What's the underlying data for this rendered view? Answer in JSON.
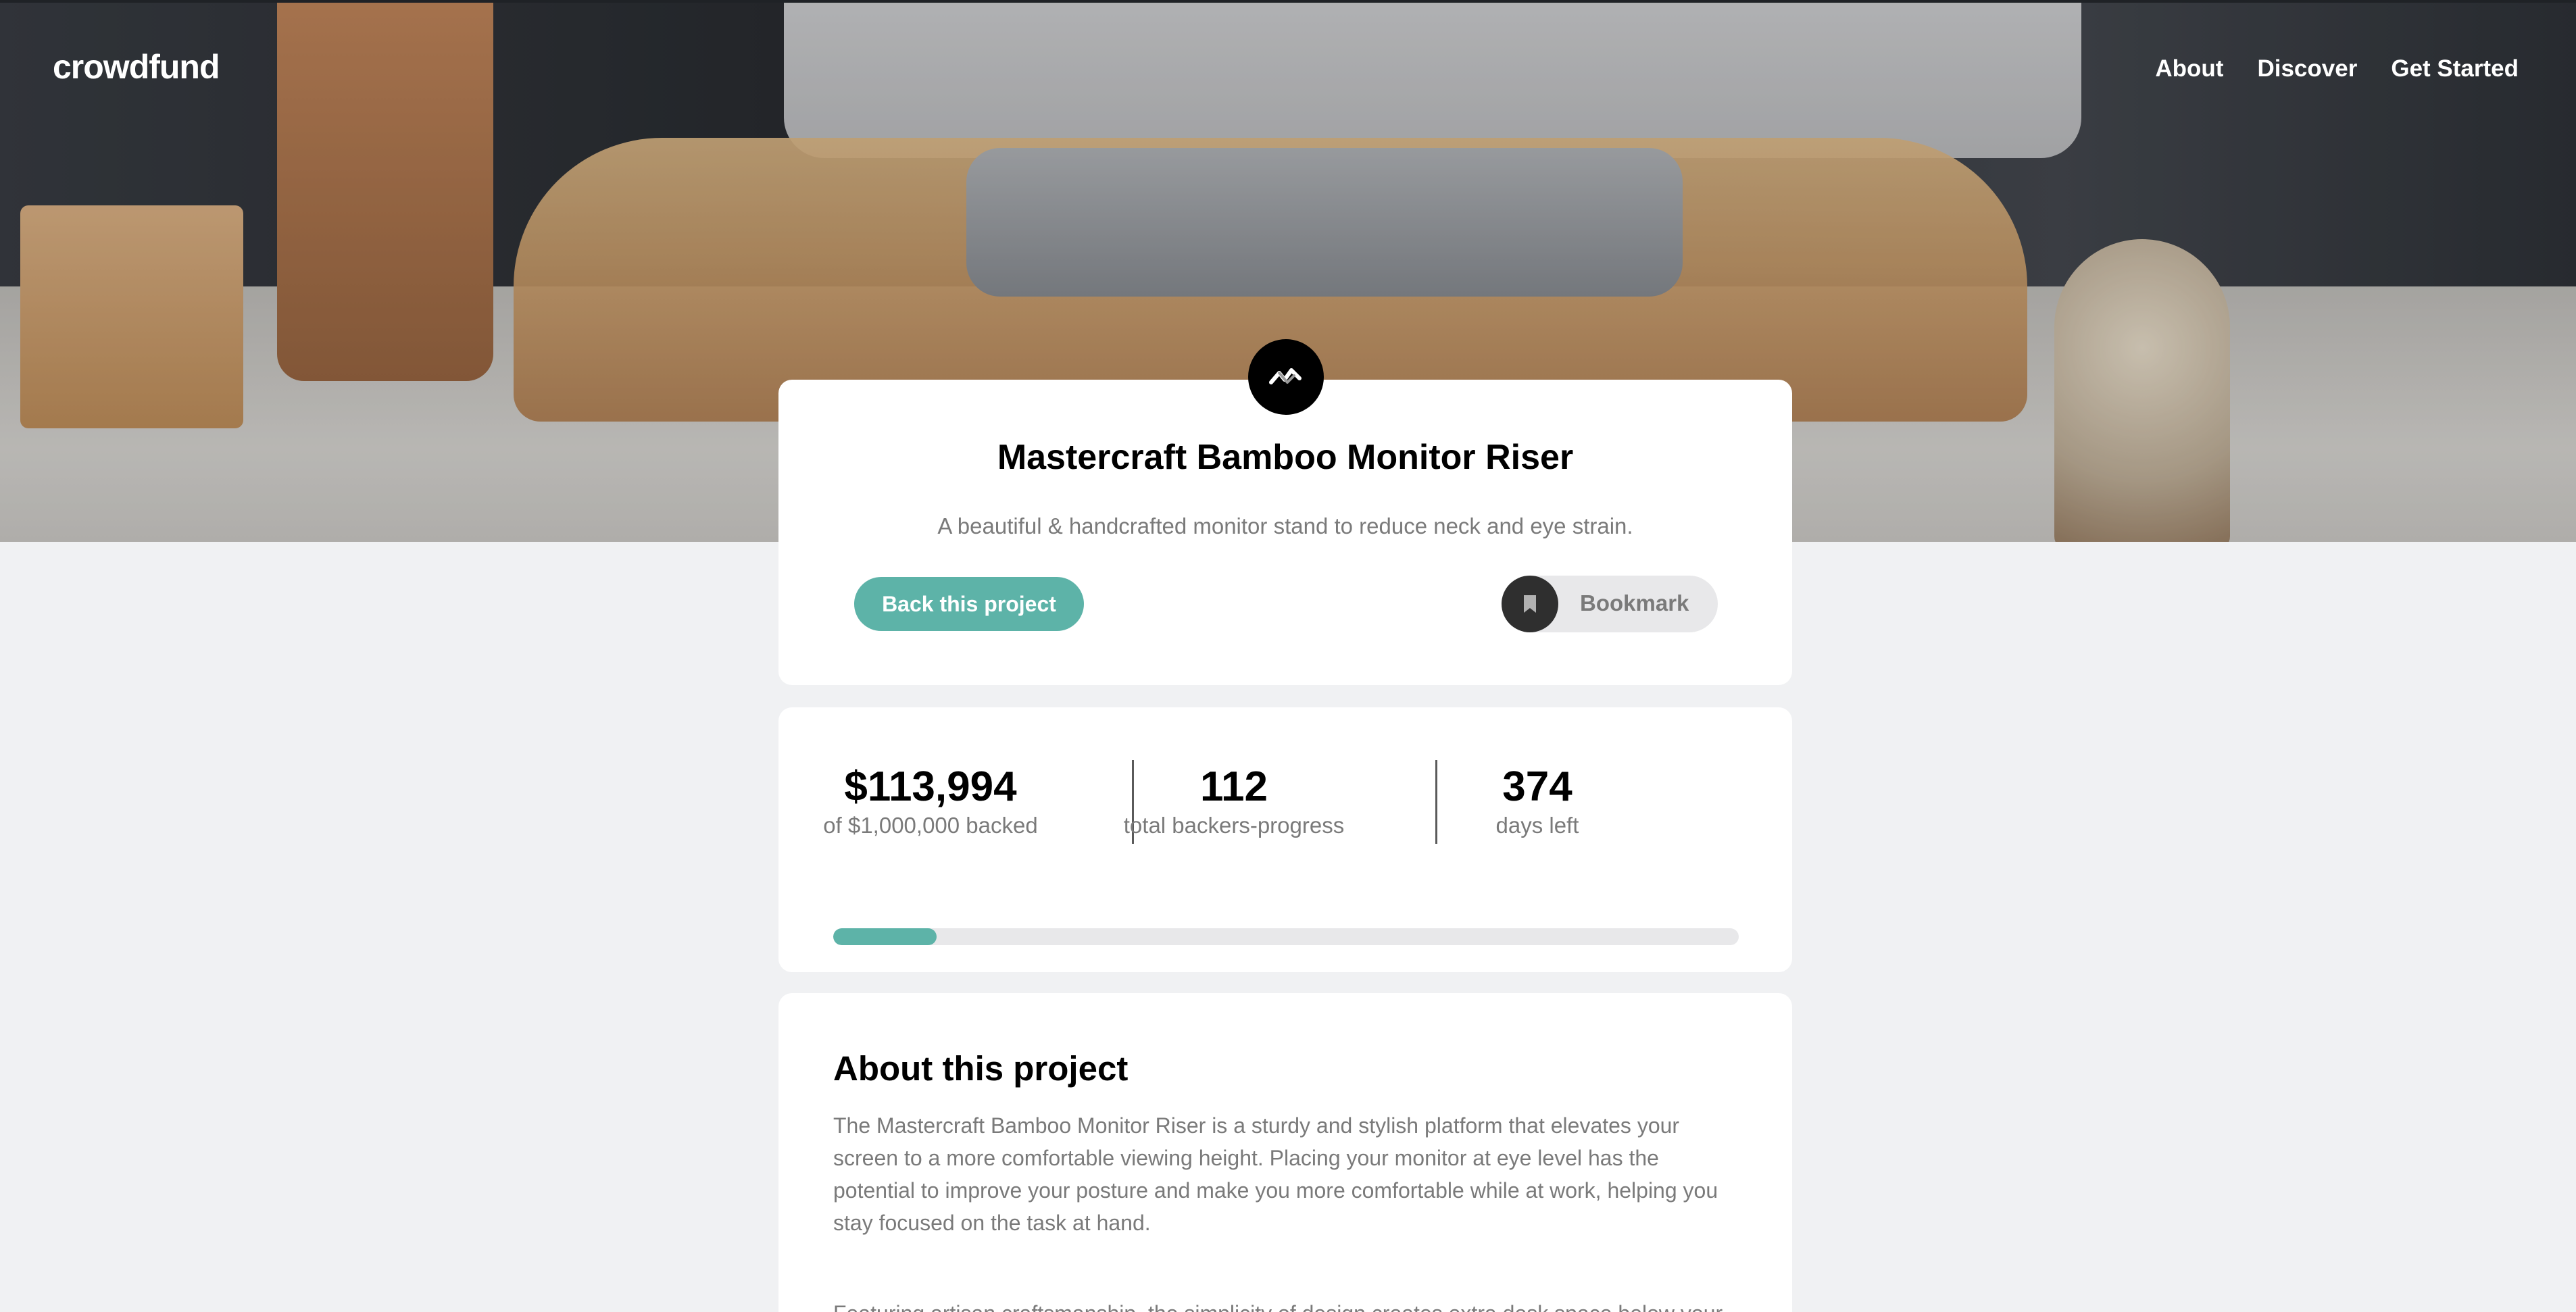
{
  "nav": {
    "logo": "crowdfund",
    "links": [
      "About",
      "Discover",
      "Get Started"
    ]
  },
  "project": {
    "title": "Mastercraft Bamboo Monitor Riser",
    "subtitle": "A beautiful & handcrafted monitor stand to reduce neck and eye strain.",
    "back_button": "Back this project",
    "bookmark_button": "Bookmark",
    "logo_icon": "mastercraft-logo-icon"
  },
  "stats": {
    "backed": {
      "value": "$113,994",
      "label": "of $1,000,000 backed"
    },
    "backers": {
      "value": "112",
      "label": "total backers-progress"
    },
    "days": {
      "value": "374",
      "label": "days left"
    },
    "progress_fraction": 0.113994
  },
  "about": {
    "title": "About this project",
    "paragraph_1": "The Mastercraft Bamboo Monitor Riser is a sturdy and stylish platform that elevates your screen to a more comfortable viewing height. Placing your monitor at eye level has the potential to improve your posture and make you more comfortable while at work, helping you stay focused on the task at hand.",
    "paragraph_2": "Featuring artisan craftsmanship, the simplicity of design creates extra desk space below your"
  },
  "colors": {
    "accent": "#5db3a8",
    "background": "#f0f1f3",
    "text_muted": "#7a7a7a"
  }
}
